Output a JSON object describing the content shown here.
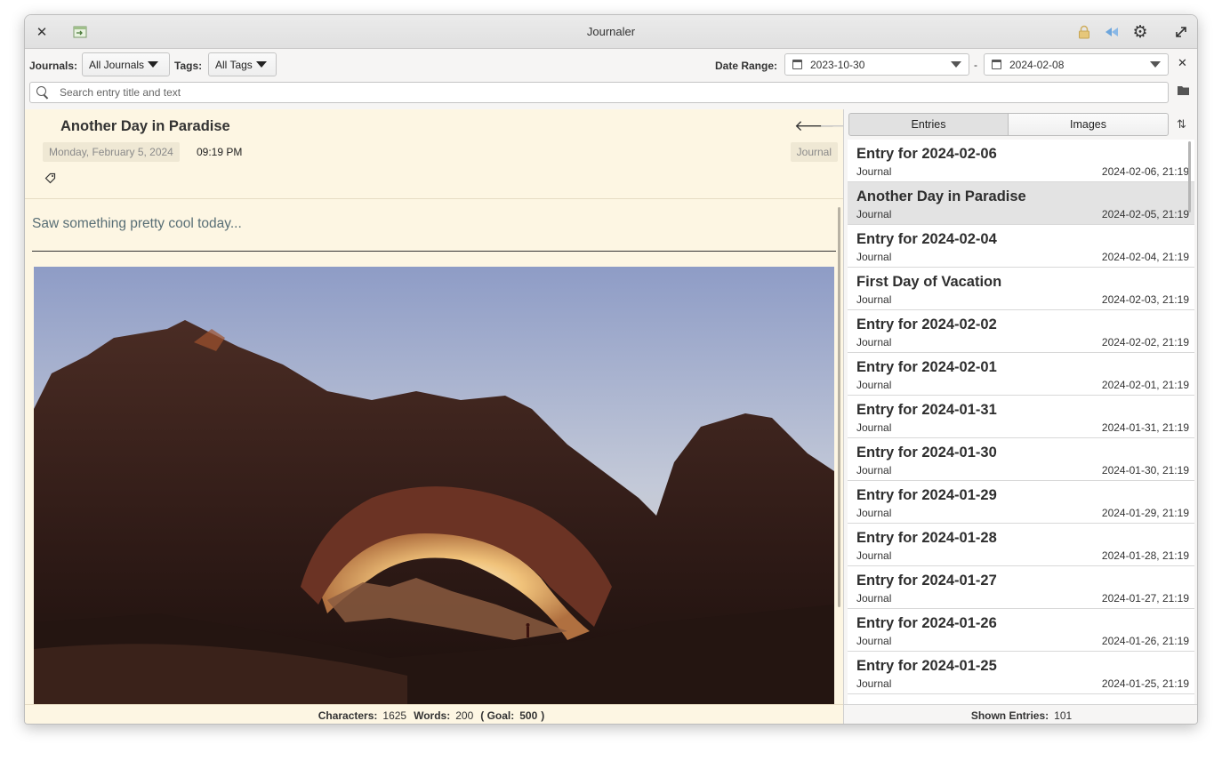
{
  "window": {
    "title": "Journaler"
  },
  "toolbar": {
    "journals_label": "Journals:",
    "journals_value": "All Journals",
    "tags_label": "Tags:",
    "tags_value": "All Tags",
    "date_range_label": "Date Range:",
    "date_from": "2023-10-30",
    "date_sep": "-",
    "date_to": "2024-02-08",
    "search_placeholder": "Search entry title and text"
  },
  "entry": {
    "title": "Another Day in Paradise",
    "date": "Monday, February  5, 2024",
    "time": "09:19 PM",
    "journal": "Journal",
    "body": "Saw something pretty cool today..."
  },
  "status": {
    "chars_label": "Characters:",
    "chars": "1625",
    "words_label": "Words:",
    "words": "200",
    "goal_open": "( Goal:",
    "goal": "500",
    "goal_close": ")"
  },
  "sidebar": {
    "tab_entries": "Entries",
    "tab_images": "Images",
    "items": [
      {
        "title": "Entry for 2024-02-06",
        "journal": "Journal",
        "date": "2024-02-06, 21:19"
      },
      {
        "title": "Another Day in Paradise",
        "journal": "Journal",
        "date": "2024-02-05, 21:19"
      },
      {
        "title": "Entry for 2024-02-04",
        "journal": "Journal",
        "date": "2024-02-04, 21:19"
      },
      {
        "title": "First Day of Vacation",
        "journal": "Journal",
        "date": "2024-02-03, 21:19"
      },
      {
        "title": "Entry for 2024-02-02",
        "journal": "Journal",
        "date": "2024-02-02, 21:19"
      },
      {
        "title": "Entry for 2024-02-01",
        "journal": "Journal",
        "date": "2024-02-01, 21:19"
      },
      {
        "title": "Entry for 2024-01-31",
        "journal": "Journal",
        "date": "2024-01-31, 21:19"
      },
      {
        "title": "Entry for 2024-01-30",
        "journal": "Journal",
        "date": "2024-01-30, 21:19"
      },
      {
        "title": "Entry for 2024-01-29",
        "journal": "Journal",
        "date": "2024-01-29, 21:19"
      },
      {
        "title": "Entry for 2024-01-28",
        "journal": "Journal",
        "date": "2024-01-28, 21:19"
      },
      {
        "title": "Entry for 2024-01-27",
        "journal": "Journal",
        "date": "2024-01-27, 21:19"
      },
      {
        "title": "Entry for 2024-01-26",
        "journal": "Journal",
        "date": "2024-01-26, 21:19"
      },
      {
        "title": "Entry for 2024-01-25",
        "journal": "Journal",
        "date": "2024-01-25, 21:19"
      }
    ],
    "shown_label": "Shown Entries:",
    "shown_count": "101"
  },
  "icons": {
    "close": "close-icon",
    "export": "export-icon",
    "lock": "lock-icon",
    "rewind": "rewind-icon",
    "settings": "gear-icon",
    "fullscreen": "fullscreen-icon"
  },
  "colors": {
    "editor_bg": "#fdf6e3",
    "body_text": "#586e75",
    "accent_blue": "#5a9bd8",
    "lock": "#d6b25a"
  }
}
